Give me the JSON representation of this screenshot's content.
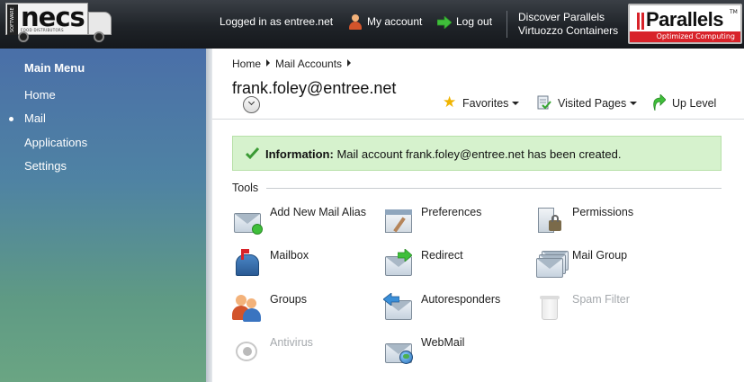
{
  "topbar": {
    "logo": {
      "name": "necs",
      "side_text": "SOFTWARE FOR",
      "sub_text": "FOOD DISTRIBUTORS"
    },
    "logged_in": "Logged in as entree.net",
    "my_account": "My account",
    "log_out": "Log out",
    "discover_line1": "Discover Parallels",
    "discover_line2": "Virtuozzo Containers",
    "parallels": {
      "name": "Parallels",
      "tm": "TM",
      "tagline": "Optimized Computing",
      "brand_color": "#d8232a"
    }
  },
  "sidebar": {
    "title": "Main Menu",
    "items": [
      {
        "label": "Home",
        "active": false
      },
      {
        "label": "Mail",
        "active": true
      },
      {
        "label": "Applications",
        "active": false
      },
      {
        "label": "Settings",
        "active": false
      }
    ]
  },
  "header": {
    "breadcrumb": [
      "Home",
      "Mail Accounts"
    ],
    "title": "frank.foley@entree.net",
    "favorites": "Favorites",
    "visited_pages": "Visited Pages",
    "up_level": "Up Level"
  },
  "info": {
    "label": "Information:",
    "message": "Mail account frank.foley@entree.net has been created."
  },
  "tools": {
    "label": "Tools",
    "items": [
      {
        "label": "Add New Mail Alias",
        "icon": "add-mail-alias-icon",
        "enabled": true
      },
      {
        "label": "Preferences",
        "icon": "preferences-icon",
        "enabled": true
      },
      {
        "label": "Permissions",
        "icon": "permissions-icon",
        "enabled": true
      },
      {
        "label": "Mailbox",
        "icon": "mailbox-icon",
        "enabled": true
      },
      {
        "label": "Redirect",
        "icon": "redirect-icon",
        "enabled": true
      },
      {
        "label": "Mail Group",
        "icon": "mail-group-icon",
        "enabled": true
      },
      {
        "label": "Groups",
        "icon": "groups-icon",
        "enabled": true
      },
      {
        "label": "Autoresponders",
        "icon": "autoresponders-icon",
        "enabled": true
      },
      {
        "label": "Spam Filter",
        "icon": "spam-filter-icon",
        "enabled": false
      },
      {
        "label": "Antivirus",
        "icon": "antivirus-icon",
        "enabled": false
      },
      {
        "label": "WebMail",
        "icon": "webmail-icon",
        "enabled": true
      }
    ]
  },
  "colors": {
    "info_background": "#d6f2cd",
    "sidebar_top": "#4a6fa8",
    "sidebar_bottom": "#6aa583"
  }
}
